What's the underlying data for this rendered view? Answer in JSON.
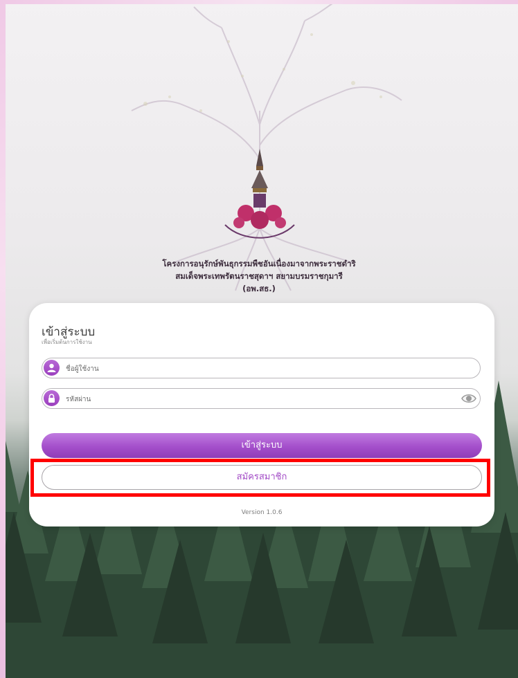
{
  "organization": {
    "line1": "โครงการอนุรักษ์พันธุกรรมพืชอันเนื่องมาจากพระราชดำริ",
    "line2": "สมเด็จพระเทพรัตนราชสุดาฯ สยามบรมราชกุมารี",
    "line3": "(อพ.สธ.)"
  },
  "login": {
    "title": "เข้าสู่ระบบ",
    "subtitle": "เพื่อเริ่มต้นการใช้งาน",
    "username_placeholder": "ชื่อผู้ใช้งาน",
    "password_placeholder": "รหัสผ่าน",
    "login_button": "เข้าสู่ระบบ",
    "register_button": "สมัครสมาชิก",
    "version": "Version 1.0.6"
  },
  "icons": {
    "user": "user-icon",
    "lock": "lock-icon",
    "eye": "eye-icon"
  },
  "colors": {
    "accent": "#a44fcb",
    "highlight": "#ff0000"
  }
}
